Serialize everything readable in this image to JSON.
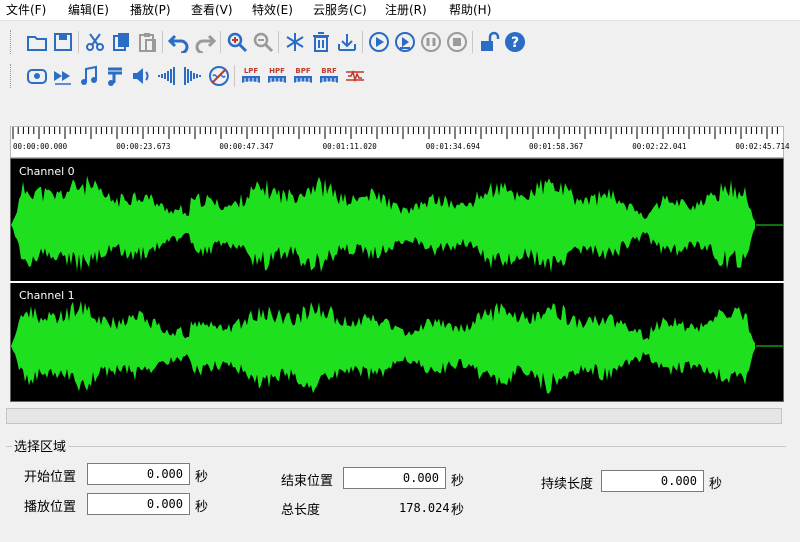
{
  "menu": [
    "文件(F)",
    "编辑(E)",
    "播放(P)",
    "查看(V)",
    "特效(E)",
    "云服务(C)",
    "注册(R)",
    "帮助(H)"
  ],
  "toolbar1": [
    {
      "name": "open-folder-icon",
      "color": "#2b6cc4"
    },
    {
      "name": "save-icon",
      "color": "#2b6cc4"
    },
    {
      "name": "cut-icon",
      "color": "#2b6cc4"
    },
    {
      "name": "copy-icon",
      "color": "#2b6cc4"
    },
    {
      "name": "paste-icon",
      "color": "#9a9a9a"
    },
    {
      "name": "undo-icon",
      "color": "#2b6cc4"
    },
    {
      "name": "redo-icon",
      "color": "#9a9a9a"
    },
    {
      "name": "zoom-in-icon",
      "color": "#2b6cc4"
    },
    {
      "name": "zoom-out-icon",
      "color": "#9a9a9a"
    },
    {
      "name": "snowflake-icon",
      "color": "#2b6cc4"
    },
    {
      "name": "delete-icon",
      "color": "#2b6cc4"
    },
    {
      "name": "trim-icon",
      "color": "#2b6cc4"
    },
    {
      "name": "play-icon",
      "color": "#2b6cc4"
    },
    {
      "name": "play-selection-icon",
      "color": "#2b6cc4"
    },
    {
      "name": "pause-icon",
      "color": "#9a9a9a"
    },
    {
      "name": "stop-icon",
      "color": "#9a9a9a"
    },
    {
      "name": "unlock-icon",
      "color": "#2b6cc4"
    },
    {
      "name": "help-icon",
      "color": "#2b6cc4"
    }
  ],
  "toolbar2": [
    {
      "name": "record-icon",
      "color": "#2b6cc4"
    },
    {
      "name": "fast-forward-icon",
      "color": "#2b6cc4"
    },
    {
      "name": "music-note-icon",
      "color": "#2b6cc4"
    },
    {
      "name": "music-notes-icon",
      "color": "#2b6cc4"
    },
    {
      "name": "volume-icon",
      "color": "#2b6cc4"
    },
    {
      "name": "fade-in-icon",
      "color": "#2b6cc4"
    },
    {
      "name": "fade-out-icon",
      "color": "#2b6cc4"
    },
    {
      "name": "noise-reduction-icon",
      "color": "#2b6cc4"
    },
    {
      "name": "lpf-filter-icon",
      "label": "LPF",
      "color": "#2b6cc4"
    },
    {
      "name": "hpf-filter-icon",
      "label": "HPF",
      "color": "#2b6cc4"
    },
    {
      "name": "bpf-filter-icon",
      "label": "BPF",
      "color": "#2b6cc4"
    },
    {
      "name": "brf-filter-icon",
      "label": "BRF",
      "color": "#2b6cc4"
    },
    {
      "name": "equalizer-icon",
      "color": "#c0392b"
    }
  ],
  "ruler": {
    "labels": [
      "00:00:00.000",
      "00:00:23.673",
      "00:00:47.347",
      "00:01:11.020",
      "00:01:34.694",
      "00:01:58.367",
      "00:02:22.041",
      "00:02:45.714"
    ]
  },
  "channels": [
    {
      "label": "Channel 0"
    },
    {
      "label": "Channel 1"
    }
  ],
  "wave_color": "#1fe01f",
  "selection": {
    "group_title": "选择区域",
    "start_label": "开始位置",
    "start_value": "0.000",
    "end_label": "结束位置",
    "end_value": "0.000",
    "duration_label": "持续长度",
    "duration_value": "0.000",
    "play_label": "播放位置",
    "play_value": "0.000",
    "total_label": "总长度",
    "total_value": "178.024",
    "unit": "秒"
  }
}
